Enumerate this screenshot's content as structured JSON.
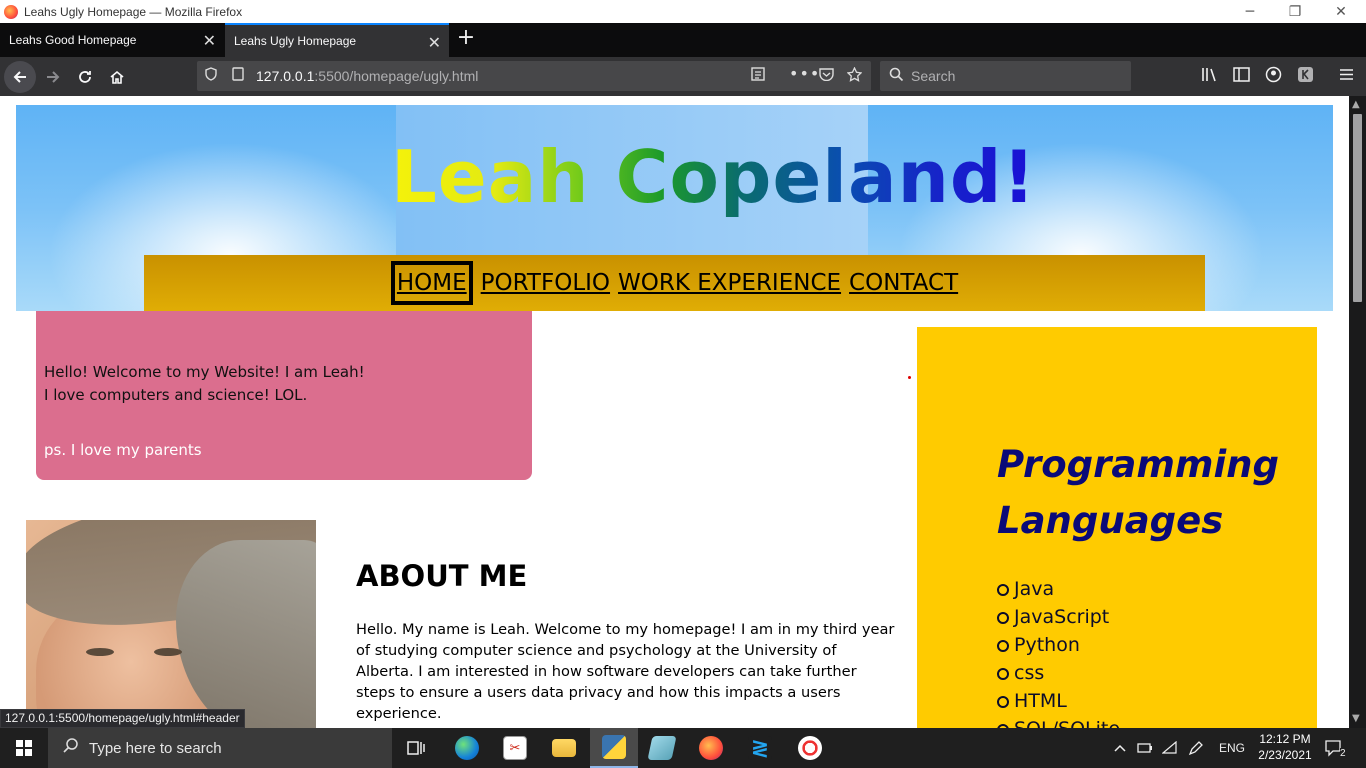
{
  "window": {
    "title": "Leahs Ugly Homepage — Mozilla Firefox",
    "controls": {
      "minimize": "─",
      "maximize": "❐",
      "close": "✕"
    }
  },
  "tabs": [
    {
      "label": "Leahs Good Homepage",
      "active": false
    },
    {
      "label": "Leahs Ugly Homepage",
      "active": true
    }
  ],
  "toolbar": {
    "url_host": "127.0.0.1",
    "url_path": ":5500/homepage/ugly.html",
    "search_placeholder": "Search"
  },
  "page": {
    "title": "Leah Copeland!",
    "nav": [
      "HOME",
      "PORTFOLIO",
      "WORK EXPERIENCE",
      "CONTACT"
    ],
    "welcome": {
      "line1": "Hello! Welcome to my Website! I am Leah!",
      "line2": "I love computers and science! LOL.",
      "line3": "ps. I love my parents"
    },
    "about": {
      "heading": "ABOUT ME",
      "text": "Hello. My name is Leah. Welcome to my homepage! I am in my third year of studying computer science and psychology at the University of Alberta. I am interested in how software developers can take further steps to ensure a users data privacy and how this impacts a users experience."
    },
    "sidebar": {
      "heading": "Programming Languages",
      "items": [
        "Java",
        "JavaScript",
        "Python",
        "css",
        "HTML",
        "SQL/SQLite"
      ]
    }
  },
  "status_url": "127.0.0.1:5500/homepage/ugly.html#header",
  "taskbar": {
    "search_placeholder": "Type here to search",
    "language": "ENG",
    "time": "12:12 PM",
    "date": "2/23/2021",
    "notification_count": "2"
  },
  "colors": {
    "nav_strip": "#e0ad05",
    "welcome_box": "#db6e8e",
    "sidebar": "#ffcb00",
    "sidebar_heading": "#0a0a78"
  }
}
